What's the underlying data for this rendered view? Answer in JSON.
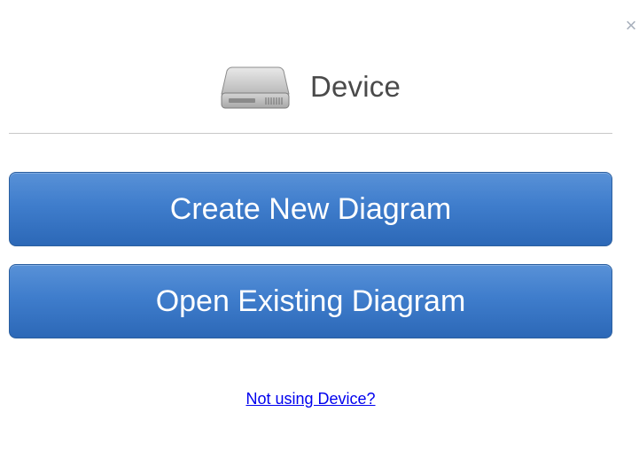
{
  "dialog": {
    "close_label": "×",
    "icon": "hard-drive-icon",
    "title": "Device",
    "buttons": {
      "create_label": "Create New Diagram",
      "open_label": "Open Existing Diagram"
    },
    "link_label": "Not using Device?"
  },
  "colors": {
    "button_blue": "#3f7dcc",
    "link_blue": "#0000ee",
    "title_gray": "#4a4a4a"
  }
}
